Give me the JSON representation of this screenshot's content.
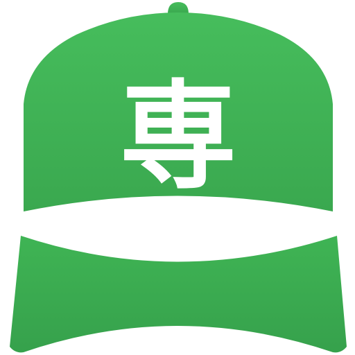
{
  "icon": {
    "name": "baseball-cap-icon",
    "label_text": "専",
    "colors": {
      "crown_top": "#46bd5c",
      "crown_bottom": "#3aa84f",
      "visor_top": "#3fb454",
      "visor_bottom": "#36a14c",
      "band": "#ffffff",
      "label": "#ffffff"
    }
  }
}
